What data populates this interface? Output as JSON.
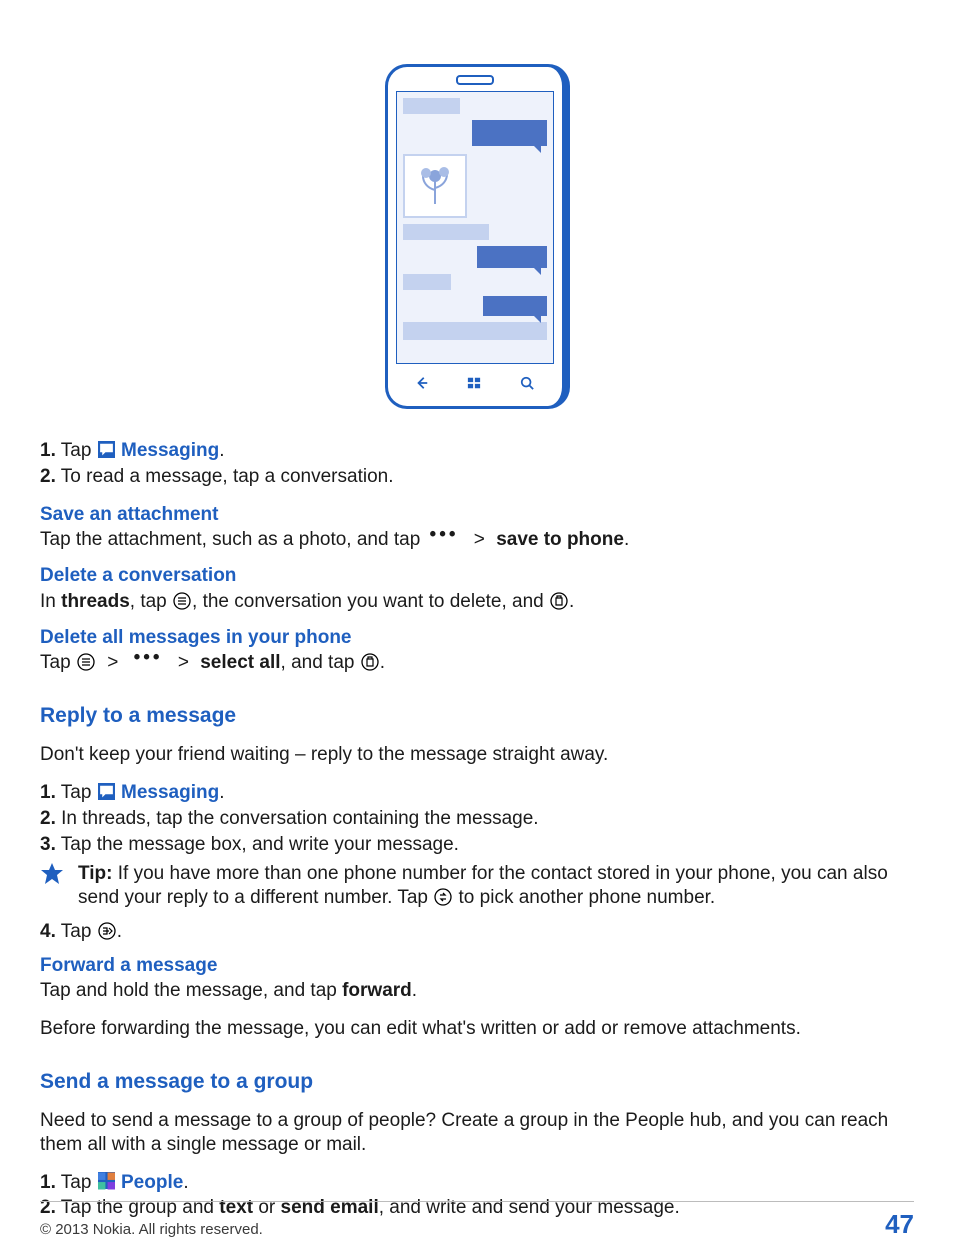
{
  "step1": {
    "num": "1.",
    "tap": "Tap",
    "label": "Messaging",
    "period": "."
  },
  "step2": {
    "num": "2.",
    "text": "To read a message, tap a conversation."
  },
  "saveAtt": {
    "head": "Save an attachment",
    "pre": "Tap the attachment, such as a photo, and tap ",
    "chev": ">",
    "bold": "save to phone",
    "post": "."
  },
  "delConv": {
    "head": "Delete a conversation",
    "p1": "In ",
    "threads": "threads",
    "p2": ", tap ",
    "p3": ", the conversation you want to delete, and ",
    "p4": "."
  },
  "delAll": {
    "head": "Delete all messages in your phone",
    "tap": "Tap ",
    "chev": ">",
    "selall": "select all",
    "and": ", and tap ",
    "period": "."
  },
  "reply": {
    "head": "Reply to a message",
    "intro": "Don't keep your friend waiting – reply to the message straight away.",
    "s1": {
      "num": "1.",
      "tap": "Tap",
      "label": "Messaging",
      "period": "."
    },
    "s2": {
      "num": "2.",
      "text": "In threads, tap the conversation containing the message."
    },
    "s3": {
      "num": "3.",
      "text": "Tap the message box, and write your message."
    },
    "tip": {
      "lead": "Tip:",
      "a": " If you have more than one phone number for the contact stored in your phone, you can also send your reply to a different number. Tap ",
      "b": " to pick another phone number."
    },
    "s4": {
      "num": "4.",
      "tap": "Tap ",
      "period": "."
    }
  },
  "fwd": {
    "head": "Forward a message",
    "line": {
      "a": "Tap and hold the message, and tap ",
      "bold": "forward",
      "b": "."
    },
    "after": "Before forwarding the message, you can edit what's written or add or remove attachments."
  },
  "group": {
    "head": "Send a message to a group",
    "intro": "Need to send a message to a group of people? Create a group in the People hub, and you can reach them all with a single message or mail.",
    "s1": {
      "num": "1.",
      "tap": "Tap",
      "label": "People",
      "period": "."
    },
    "s2": {
      "num": "2.",
      "a": "Tap the group and ",
      "text_b": "text",
      "or": " or ",
      "email_b": "send email",
      "b": ", and write and send your message."
    }
  },
  "footer": {
    "copyright": "© 2013 Nokia. All rights reserved.",
    "page": "47"
  }
}
